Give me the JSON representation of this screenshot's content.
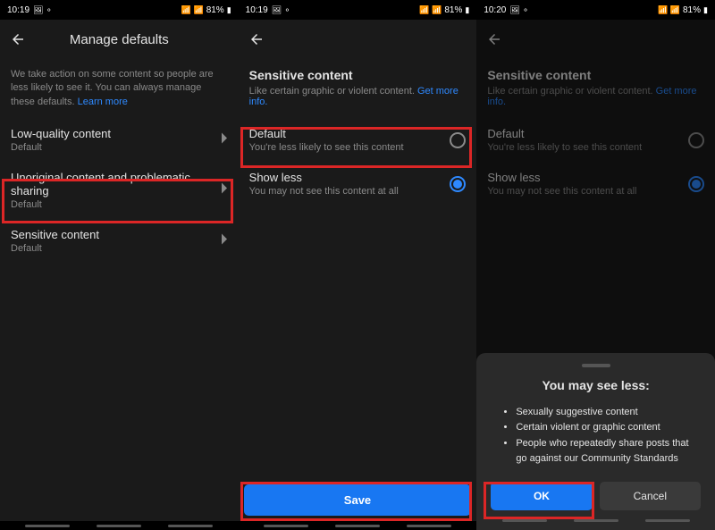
{
  "status": {
    "time1": "10:19",
    "time2": "10:19",
    "time3": "10:20",
    "battery": "81%",
    "icons_left": "⬛ ⚬"
  },
  "screen1": {
    "title": "Manage defaults",
    "intro": "We take action on some content so people are less likely to see it. You can always manage these defaults. ",
    "learn_more": "Learn more",
    "items": [
      {
        "title": "Low-quality content",
        "sub": "Default"
      },
      {
        "title": "Unoriginal content and problematic sharing",
        "sub": "Default"
      },
      {
        "title": "Sensitive content",
        "sub": "Default"
      }
    ]
  },
  "screen2": {
    "title": "Sensitive content",
    "desc": "Like certain graphic or violent content. ",
    "get_more": "Get more info.",
    "options": [
      {
        "title": "Default",
        "sub": "You're less likely to see this content"
      },
      {
        "title": "Show less",
        "sub": "You may not see this content at all"
      }
    ],
    "save": "Save"
  },
  "screen3": {
    "sheet_title": "You may see less:",
    "bullets": [
      "Sexually suggestive content",
      "Certain violent or graphic content",
      "People who repeatedly share posts that go against our Community Standards"
    ],
    "ok": "OK",
    "cancel": "Cancel"
  }
}
